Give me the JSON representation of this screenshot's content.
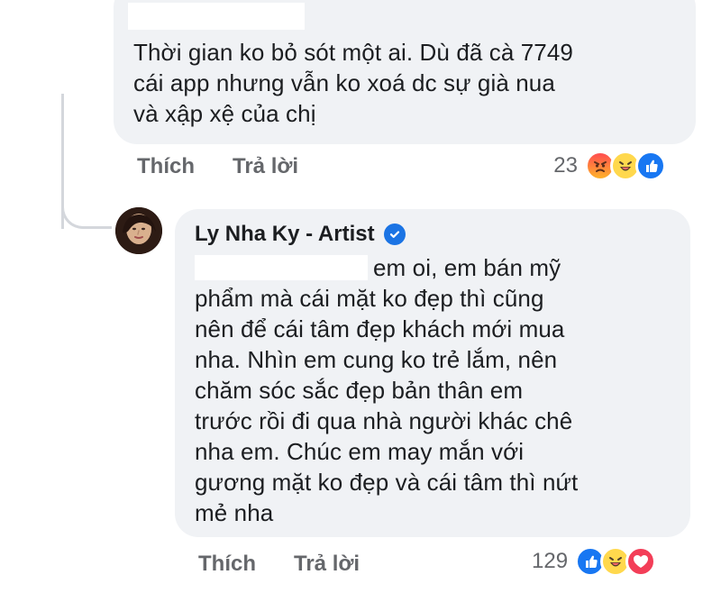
{
  "comment_1": {
    "text_lines": [
      "Thời gian ko bỏ sót một ai. Dù đã cà 7749",
      "cái app nhưng vẫn ko xoá dc sự già nua",
      "và xập xệ của chị"
    ],
    "actions": {
      "like": "Thích",
      "reply": "Trả lời"
    },
    "reaction_count": "23"
  },
  "comment_2": {
    "author": "Ly Nha Ky - Artist",
    "text_lines": [
      "em oi, em bán mỹ",
      "phẩm mà cái mặt ko đẹp thì cũng",
      "nên để cái tâm đẹp khách mới mua",
      "nha. Nhìn em cung ko trẻ lắm, nên",
      "chăm sóc sắc đẹp bản thân em",
      "trước rồi đi qua nhà người khác chê",
      "nha em. Chúc em may mắn với",
      "gương mặt ko đẹp và cái tâm thì nứt",
      "mẻ nha"
    ],
    "actions": {
      "like": "Thích",
      "reply": "Trả lời"
    },
    "reaction_count": "129"
  },
  "icons": {
    "verified": "verified-check-icon",
    "angry": "angry-reaction-icon",
    "haha": "haha-reaction-icon",
    "like": "like-reaction-icon",
    "love": "love-reaction-icon"
  },
  "colors": {
    "bubble_background": "#f0f2f5",
    "text": "#1c1e21",
    "muted_text": "#65676b",
    "verified": "#1b74e4",
    "like": "#1877f2",
    "love": "#f33e58"
  }
}
